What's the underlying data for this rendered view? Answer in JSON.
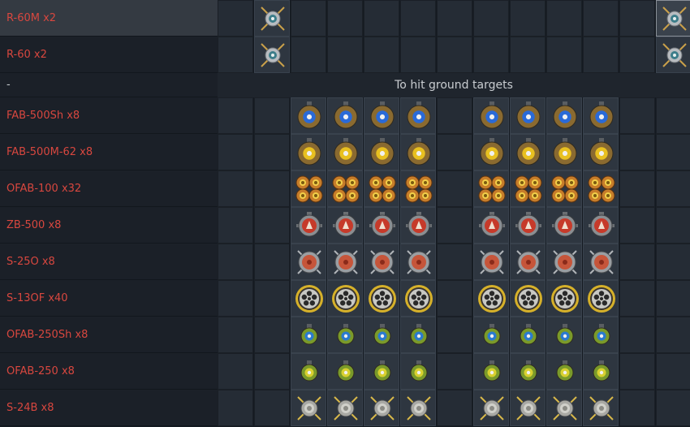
{
  "section_label": "-",
  "section_title": "To hit ground targets",
  "slot_count": 13,
  "rows": [
    {
      "label": "R-60M x2",
      "icon": "air-to-air-missile-icon",
      "selected": true,
      "slots": [
        1,
        12
      ],
      "selected_slots": [
        12
      ]
    },
    {
      "label": "R-60 x2",
      "icon": "air-to-air-missile-icon",
      "slots": [
        1,
        12
      ]
    },
    {
      "label": "FAB-500Sh x8",
      "icon": "bomb-blue-icon",
      "slots": [
        2,
        3,
        4,
        5,
        7,
        8,
        9,
        10
      ]
    },
    {
      "label": "FAB-500M-62 x8",
      "icon": "bomb-yellow-icon",
      "slots": [
        2,
        3,
        4,
        5,
        7,
        8,
        9,
        10
      ]
    },
    {
      "label": "OFAB-100 x32",
      "icon": "small-bomb-cluster-icon",
      "slots": [
        2,
        3,
        4,
        5,
        7,
        8,
        9,
        10
      ]
    },
    {
      "label": "ZB-500 x8",
      "icon": "incendiary-bomb-icon",
      "slots": [
        2,
        3,
        4,
        5,
        7,
        8,
        9,
        10
      ]
    },
    {
      "label": "S-25O x8",
      "icon": "rocket-red-icon",
      "slots": [
        2,
        3,
        4,
        5,
        7,
        8,
        9,
        10
      ]
    },
    {
      "label": "S-13OF x40",
      "icon": "rocket-pod-icon",
      "slots": [
        2,
        3,
        4,
        5,
        7,
        8,
        9,
        10
      ]
    },
    {
      "label": "OFAB-250Sh x8",
      "icon": "bomb-green-blue-icon",
      "slots": [
        2,
        3,
        4,
        5,
        7,
        8,
        9,
        10
      ]
    },
    {
      "label": "OFAB-250 x8",
      "icon": "bomb-green-yellow-icon",
      "slots": [
        2,
        3,
        4,
        5,
        7,
        8,
        9,
        10
      ]
    },
    {
      "label": "S-24B x8",
      "icon": "rocket-gold-icon",
      "slots": [
        2,
        3,
        4,
        5,
        7,
        8,
        9,
        10
      ]
    }
  ]
}
